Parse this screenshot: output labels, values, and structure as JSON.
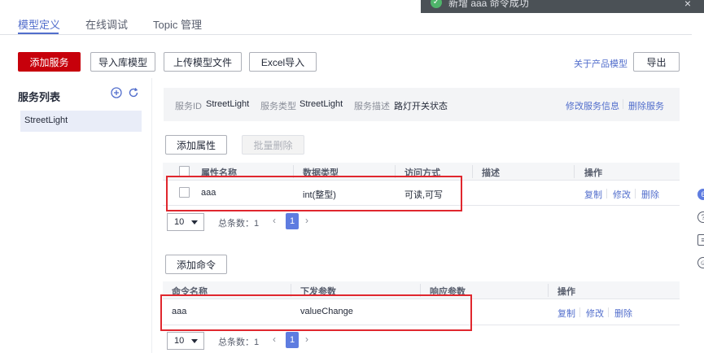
{
  "toast": {
    "message": "新增 aaa 命令成功",
    "close": "×"
  },
  "tabs": [
    {
      "label": "模型定义",
      "active": true
    },
    {
      "label": "在线调试",
      "active": false
    },
    {
      "label": "Topic 管理",
      "active": false
    }
  ],
  "toolbar": {
    "add_service": "添加服务",
    "import_model": "导入库模型",
    "upload_model": "上传模型文件",
    "excel_import": "Excel导入",
    "about_model": "关于产品模型",
    "export": "导出"
  },
  "service_list": {
    "title": "服务列表",
    "items": [
      "StreetLight"
    ]
  },
  "service_info": {
    "id_label": "服务ID",
    "id_value": "StreetLight",
    "type_label": "服务类型",
    "type_value": "StreetLight",
    "desc_label": "服务描述",
    "desc_value": "路灯开关状态",
    "edit": "修改服务信息",
    "delete": "删除服务"
  },
  "properties": {
    "add": "添加属性",
    "batch_delete": "批量删除",
    "columns": [
      "属性名称",
      "数据类型",
      "访问方式",
      "描述",
      "操作"
    ],
    "rows": [
      {
        "name": "aaa",
        "type": "int(整型)",
        "access": "可读,可写",
        "desc": ""
      }
    ],
    "actions": [
      "复制",
      "修改",
      "删除"
    ],
    "pagination": {
      "page_size": "10",
      "total": "总条数：1",
      "current": "1"
    }
  },
  "commands": {
    "add": "添加命令",
    "columns": [
      "命令名称",
      "下发参数",
      "响应参数",
      "操作"
    ],
    "rows": [
      {
        "name": "aaa",
        "send_params": "valueChange",
        "resp_params": ""
      }
    ],
    "actions": [
      "复制",
      "修改",
      "删除"
    ],
    "pagination": {
      "page_size": "10",
      "total": "总条数：1",
      "current": "1"
    }
  },
  "colors": {
    "brand": "#c7000b",
    "accent": "#526ecc",
    "highlight_box": "#e0272e",
    "success": "#4fb56b"
  }
}
